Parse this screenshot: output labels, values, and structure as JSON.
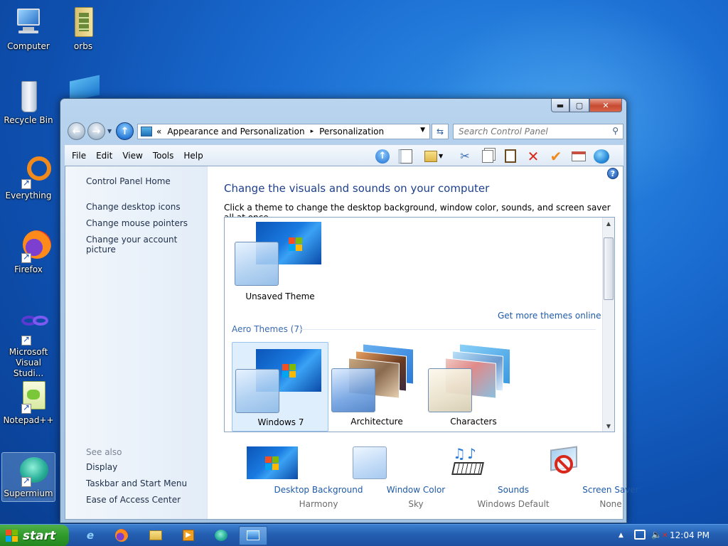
{
  "desktop": {
    "icons": [
      {
        "label": "Computer"
      },
      {
        "label": "orbs"
      },
      {
        "label": "Recycle Bin"
      },
      {
        "label": "Everything"
      },
      {
        "label": "Firefox"
      },
      {
        "label": "Microsoft Visual Studi..."
      },
      {
        "label": "Notepad++"
      },
      {
        "label": "Supermium"
      }
    ]
  },
  "window": {
    "address": {
      "overflow": "«",
      "crumbs": [
        "Appearance and Personalization",
        "Personalization"
      ],
      "separator": "▸"
    },
    "search_placeholder": "Search Control Panel",
    "menu": [
      "File",
      "Edit",
      "View",
      "Tools",
      "Help"
    ],
    "left_pane": {
      "home": "Control Panel Home",
      "links": [
        "Change desktop icons",
        "Change mouse pointers",
        "Change your account picture"
      ],
      "see_also_title": "See also",
      "see_also": [
        "Display",
        "Taskbar and Start Menu",
        "Ease of Access Center"
      ]
    },
    "main": {
      "title": "Change the visuals and sounds on your computer",
      "subtitle": "Click a theme to change the desktop background, window color, sounds, and screen saver all at once.",
      "unsaved_theme": "Unsaved Theme",
      "more_themes": "Get more themes online",
      "aero_header": "Aero Themes (7)",
      "themes": [
        "Windows 7",
        "Architecture",
        "Characters"
      ],
      "selected_theme": "Windows 7"
    },
    "bottom": [
      {
        "label": "Desktop Background",
        "value": "Harmony"
      },
      {
        "label": "Window Color",
        "value": "Sky"
      },
      {
        "label": "Sounds",
        "value": "Windows Default"
      },
      {
        "label": "Screen Saver",
        "value": "None"
      }
    ]
  },
  "taskbar": {
    "start_label": "start",
    "clock": "12:04 PM"
  },
  "colors": {
    "link": "#1e5aa8",
    "title": "#1e3f8c",
    "taskbar": "#245fb2",
    "start": "#2f9a2c"
  }
}
